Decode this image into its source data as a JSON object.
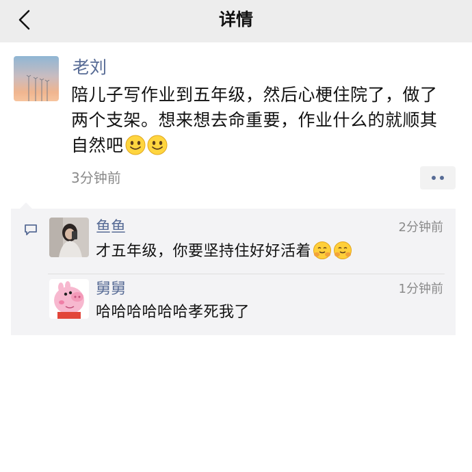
{
  "nav": {
    "title": "详情",
    "back_icon": "chevron-left-icon"
  },
  "post": {
    "author": "老刘",
    "text": "陪儿子写作业到五年级，然后心梗住院了，做了两个支架。想来想去命重要，作业什么的就顺其自然吧",
    "emojis": [
      "smile-emoji",
      "smile-emoji"
    ],
    "time": "3分钟前",
    "more_icon": "more-dots-icon"
  },
  "comments": [
    {
      "name": "鱼鱼",
      "time": "2分钟前",
      "text": "才五年级，你要坚持住好好活着",
      "emojis": [
        "hug-emoji",
        "hug-emoji"
      ]
    },
    {
      "name": "舅舅",
      "time": "1分钟前",
      "text": "哈哈哈哈哈哈孝死我了"
    }
  ],
  "colors": {
    "link": "#576b95",
    "nav_bg": "#ededed",
    "panel_bg": "#f3f3f5",
    "muted": "#8a8a8a"
  }
}
